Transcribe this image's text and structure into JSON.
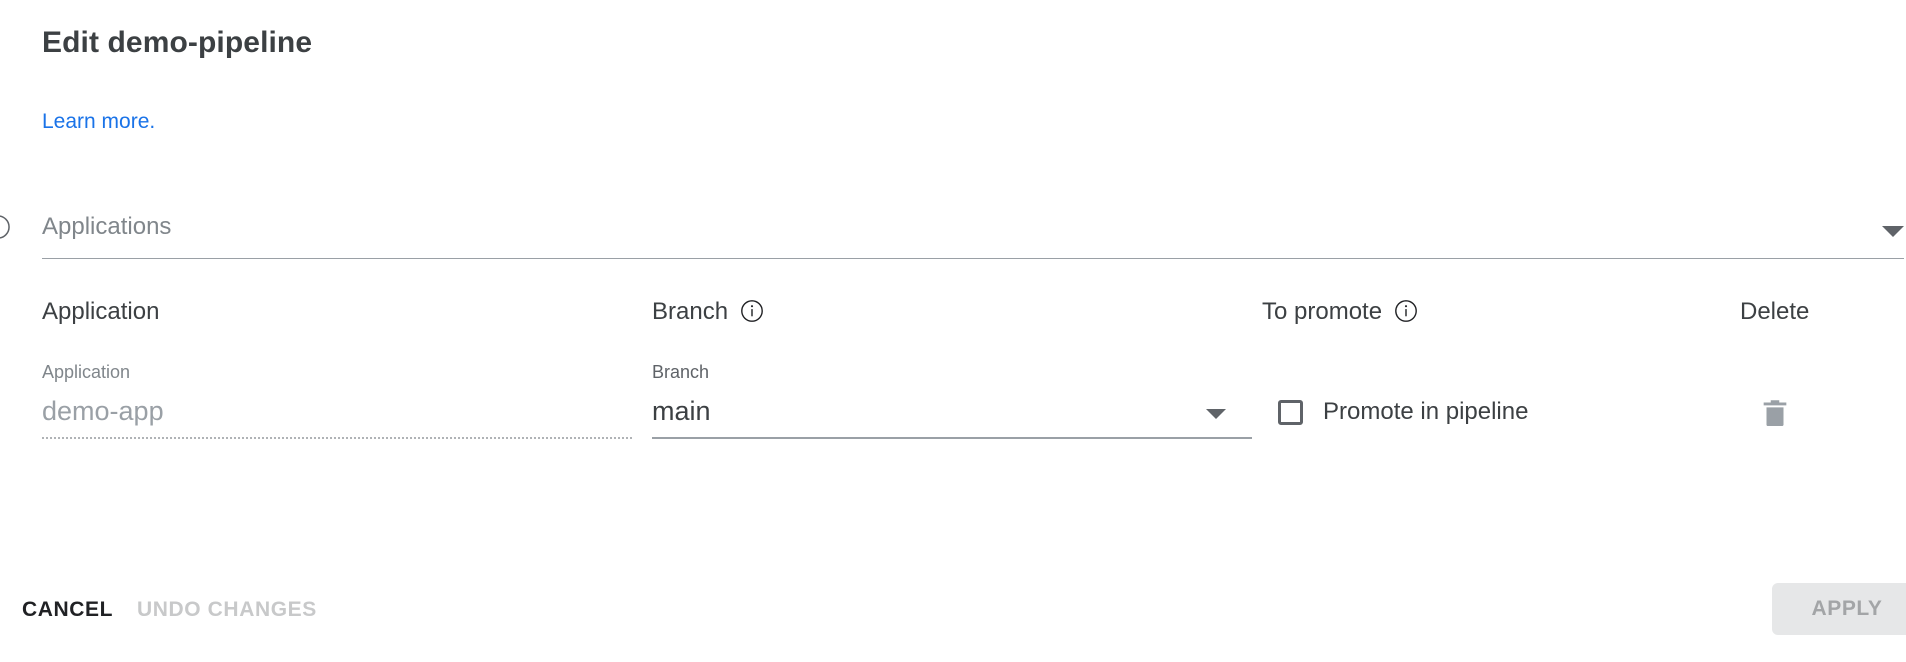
{
  "dialog": {
    "title": "Edit demo-pipeline",
    "learn_more_label": "Learn more.",
    "learn_more_color": "#1a73e8"
  },
  "applications_select": {
    "placeholder": "Applications",
    "value": "",
    "info_icon": "info-circle-icon",
    "dropdown_icon": "chevron-down-icon"
  },
  "table": {
    "headers": {
      "application": "Application",
      "branch": "Branch",
      "to_promote": "To promote",
      "delete": "Delete"
    },
    "header_info_icons": {
      "branch": "info-circle-icon",
      "to_promote": "info-circle-icon"
    },
    "rows": [
      {
        "application_label": "Application",
        "application_value": "demo-app",
        "application_disabled": true,
        "branch_label": "Branch",
        "branch_value": "main",
        "branch_dropdown_icon": "chevron-down-icon",
        "promote_checked": false,
        "promote_label": "Promote in pipeline",
        "delete_icon": "trash-icon"
      }
    ]
  },
  "footer": {
    "cancel_label": "CANCEL",
    "undo_label": "UNDO CHANGES",
    "undo_disabled": true,
    "apply_label": "APPLY",
    "apply_disabled": true
  }
}
